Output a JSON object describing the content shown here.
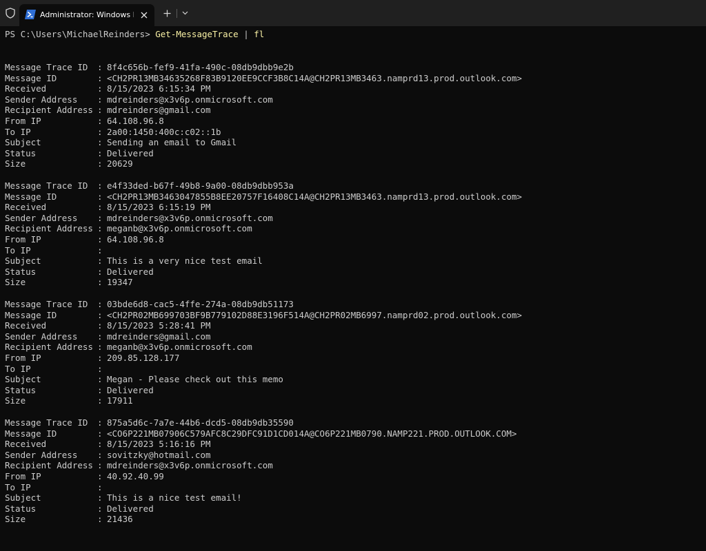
{
  "window": {
    "tab_title": "Administrator: Windows PowerShell",
    "icons": {
      "shield": "shield-icon",
      "tab": "powershell-icon",
      "close": "close-icon",
      "new_tab": "plus-icon",
      "dropdown": "chevron-down-icon"
    }
  },
  "terminal": {
    "prompt": "PS C:\\Users\\MichaelReinders> ",
    "command": "Get-MessageTrace",
    "pipe": " | ",
    "format_cmd": "fl",
    "separator": ":",
    "labels": {
      "trace_id": "Message Trace ID",
      "message_id": "Message ID",
      "received": "Received",
      "sender": "Sender Address",
      "recipient": "Recipient Address",
      "from_ip": "From IP",
      "to_ip": "To IP",
      "subject": "Subject",
      "status": "Status",
      "size": "Size"
    },
    "records": [
      {
        "trace_id": "8f4c656b-fef9-41fa-490c-08db9dbb9e2b",
        "message_id": "<CH2PR13MB34635268F83B9120EE9CCF3B8C14A@CH2PR13MB3463.namprd13.prod.outlook.com>",
        "received": "8/15/2023 6:15:34 PM",
        "sender": "mdreinders@x3v6p.onmicrosoft.com",
        "recipient": "mdreinders@gmail.com",
        "from_ip": "64.108.96.8",
        "to_ip": "2a00:1450:400c:c02::1b",
        "subject": "Sending an email to Gmail",
        "status": "Delivered",
        "size": "20629"
      },
      {
        "trace_id": "e4f33ded-b67f-49b8-9a00-08db9dbb953a",
        "message_id": "<CH2PR13MB3463047855B8EE20757F16408C14A@CH2PR13MB3463.namprd13.prod.outlook.com>",
        "received": "8/15/2023 6:15:19 PM",
        "sender": "mdreinders@x3v6p.onmicrosoft.com",
        "recipient": "meganb@x3v6p.onmicrosoft.com",
        "from_ip": "64.108.96.8",
        "to_ip": "",
        "subject": "This is a very nice test email",
        "status": "Delivered",
        "size": "19347"
      },
      {
        "trace_id": "03bde6d8-cac5-4ffe-274a-08db9db51173",
        "message_id": "<CH2PR02MB699703BF9B779102D88E3196F514A@CH2PR02MB6997.namprd02.prod.outlook.com>",
        "received": "8/15/2023 5:28:41 PM",
        "sender": "mdreinders@gmail.com",
        "recipient": "meganb@x3v6p.onmicrosoft.com",
        "from_ip": "209.85.128.177",
        "to_ip": "",
        "subject": "Megan - Please check out this memo",
        "status": "Delivered",
        "size": "17911"
      },
      {
        "trace_id": "875a5d6c-7a7e-44b6-dcd5-08db9db35590",
        "message_id": "<CO6P221MB07906C579AFC8C29DFC91D1CD014A@CO6P221MB0790.NAMP221.PROD.OUTLOOK.COM>",
        "received": "8/15/2023 5:16:16 PM",
        "sender": "sovitzky@hotmail.com",
        "recipient": "mdreinders@x3v6p.onmicrosoft.com",
        "from_ip": "40.92.40.99",
        "to_ip": "",
        "subject": "This is a nice test email!",
        "status": "Delivered",
        "size": "21436"
      }
    ]
  },
  "colors": {
    "background": "#0c0c0c",
    "titlebar": "#202020",
    "text": "#cccccc",
    "command": "#f9f1a5",
    "tab_icon": "#2f6fd6"
  }
}
